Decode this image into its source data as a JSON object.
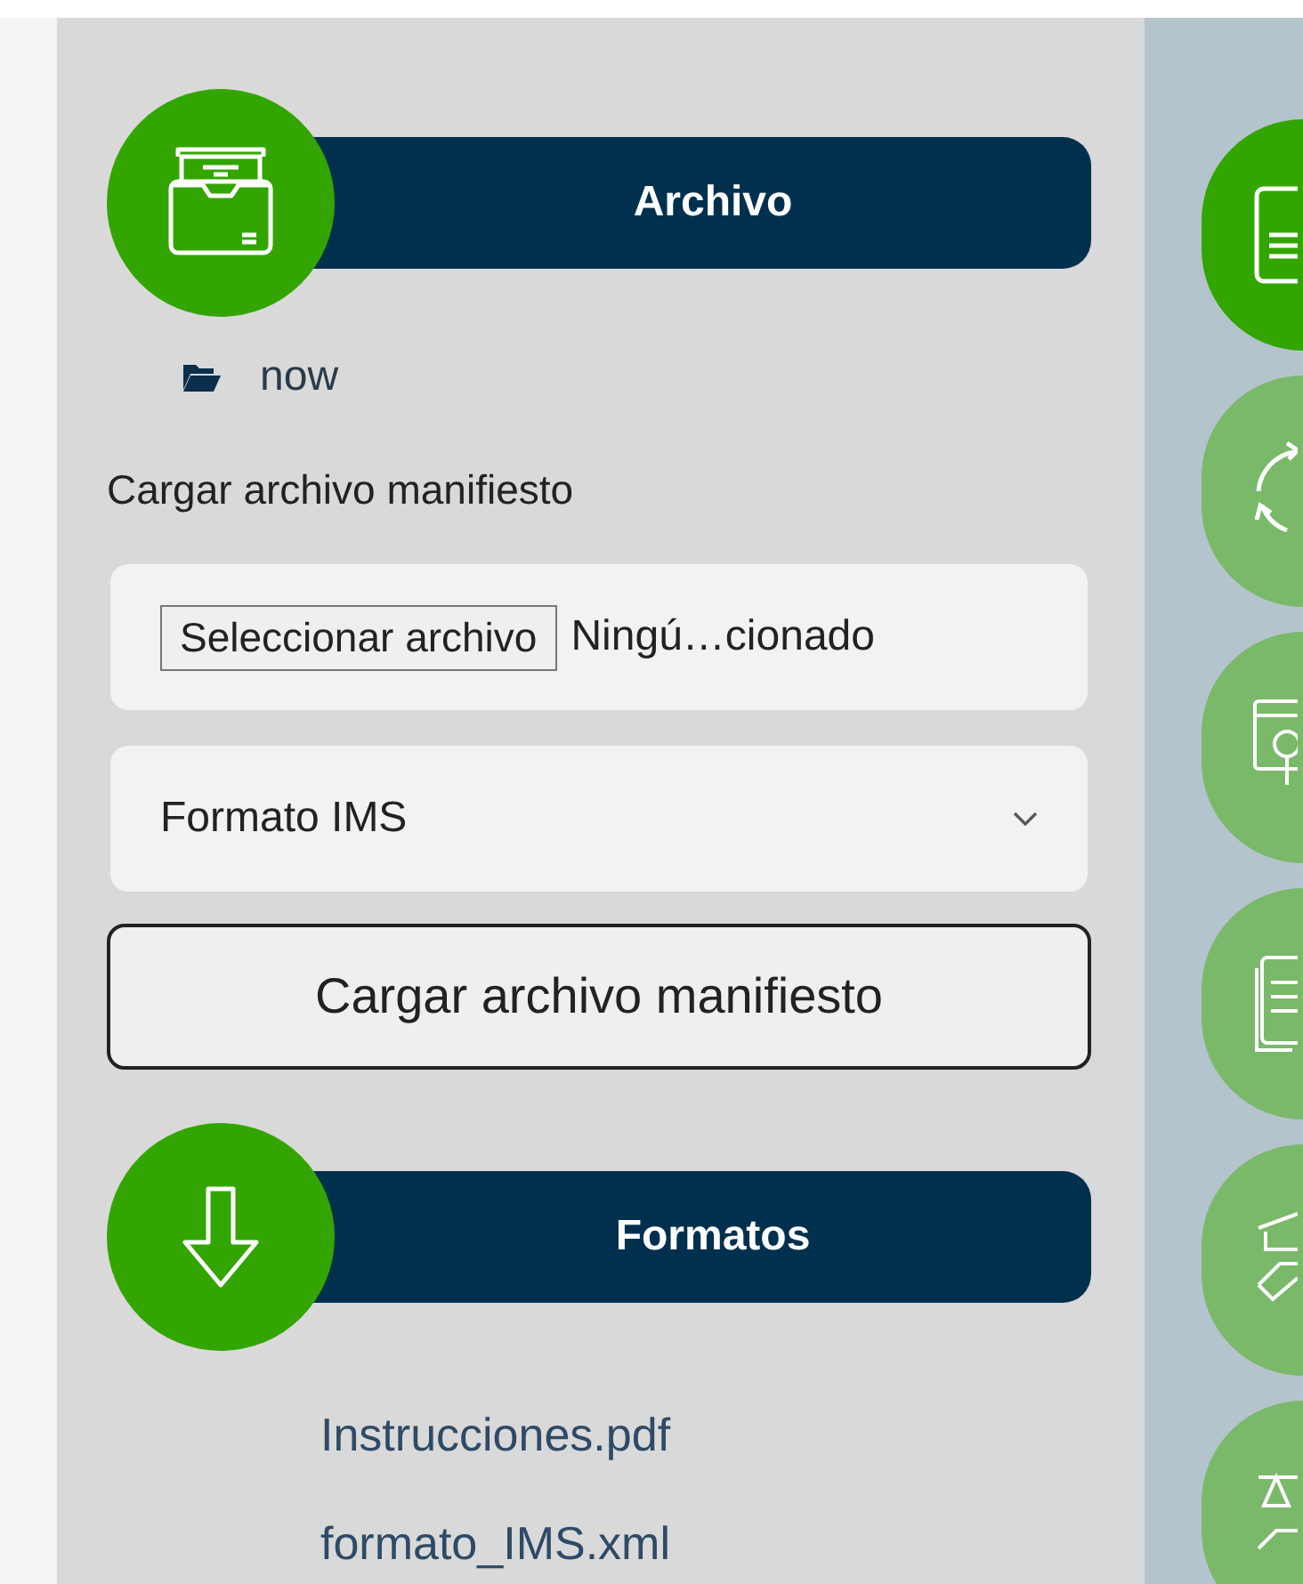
{
  "archive_section": {
    "title": "Archivo",
    "folder": "now",
    "label": "Cargar archivo manifiesto",
    "file_input": {
      "button": "Seleccionar archivo",
      "status": "Ningú…cionado"
    },
    "format_select": {
      "value": "Formato IMS"
    },
    "submit_button": "Cargar archivo manifiesto"
  },
  "formats_section": {
    "title": "Formatos",
    "links": [
      "Instrucciones.pdf",
      "formato_IMS.xml"
    ]
  },
  "side_nav": [
    {
      "kind": "document",
      "selected": true
    },
    {
      "kind": "cycle",
      "selected": false
    },
    {
      "kind": "code-search",
      "selected": false
    },
    {
      "kind": "notes",
      "selected": false
    },
    {
      "kind": "graduation",
      "selected": false
    },
    {
      "kind": "scale",
      "selected": false
    }
  ]
}
